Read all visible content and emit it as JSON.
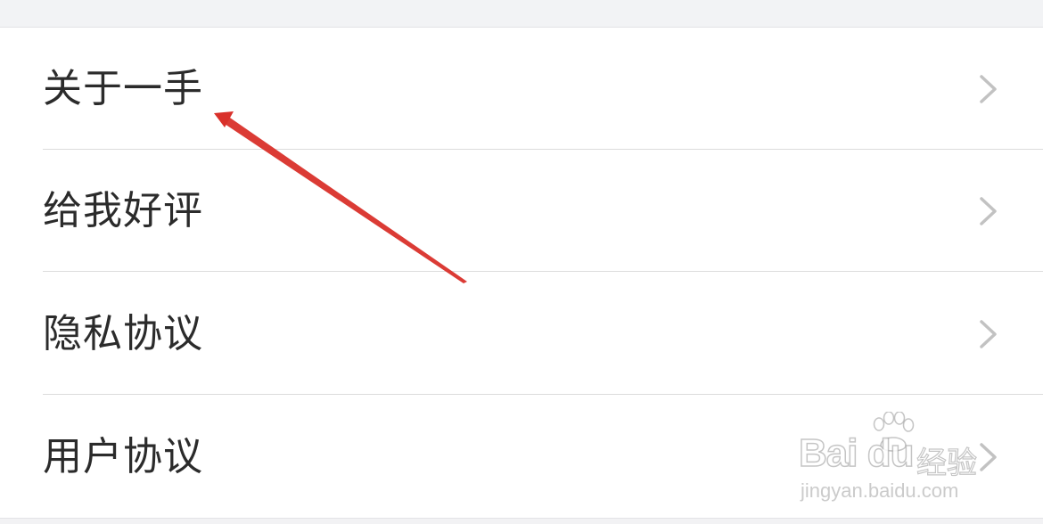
{
  "settings_list": {
    "items": [
      {
        "label": "关于一手"
      },
      {
        "label": "给我好评"
      },
      {
        "label": "隐私协议"
      },
      {
        "label": "用户协议"
      }
    ],
    "chevron_icon": "chevron-right-icon"
  },
  "annotation": {
    "type": "red-arrow",
    "color": "#d9302a",
    "points_to": "关于一手"
  },
  "watermark": {
    "logo_text": "Bai du",
    "product_text": "经验",
    "url_text": "jingyan.baidu.com"
  },
  "colors": {
    "background": "#f2f3f5",
    "row_background": "#ffffff",
    "label_text": "#2b2b2b",
    "chevron": "#c2c2c2",
    "divider": "#dcdcdc"
  }
}
